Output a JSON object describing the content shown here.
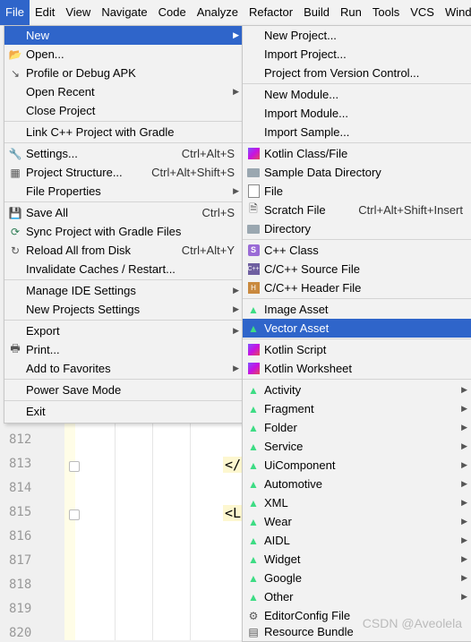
{
  "menubar": {
    "items": [
      {
        "label": "File",
        "active": true
      },
      {
        "label": "Edit"
      },
      {
        "label": "View"
      },
      {
        "label": "Navigate"
      },
      {
        "label": "Code"
      },
      {
        "label": "Analyze"
      },
      {
        "label": "Refactor"
      },
      {
        "label": "Build"
      },
      {
        "label": "Run"
      },
      {
        "label": "Tools"
      },
      {
        "label": "VCS"
      },
      {
        "label": "Wind"
      }
    ]
  },
  "editor": {
    "line_numbers": [
      "812",
      "813",
      "814",
      "815",
      "816",
      "817",
      "818",
      "819",
      "820"
    ],
    "code_tags": [
      "</",
      "<L"
    ]
  },
  "file_menu": {
    "items": [
      {
        "label": "New",
        "highlight": true,
        "submenu": true
      },
      {
        "label": "Open...",
        "icon": "folder-open-icon"
      },
      {
        "label": "Profile or Debug APK",
        "icon": "profile-icon"
      },
      {
        "label": "Open Recent",
        "submenu": true
      },
      {
        "label": "Close Project"
      },
      {
        "label": "Link C++ Project with Gradle"
      },
      {
        "label": "Settings...",
        "shortcut": "Ctrl+Alt+S",
        "icon": "wrench-icon"
      },
      {
        "label": "Project Structure...",
        "shortcut": "Ctrl+Alt+Shift+S",
        "icon": "project-structure-icon"
      },
      {
        "label": "File Properties",
        "submenu": true
      },
      {
        "label": "Save All",
        "shortcut": "Ctrl+S",
        "icon": "save-icon"
      },
      {
        "label": "Sync Project with Gradle Files",
        "icon": "gradle-sync-icon"
      },
      {
        "label": "Reload All from Disk",
        "shortcut": "Ctrl+Alt+Y",
        "icon": "reload-icon"
      },
      {
        "label": "Invalidate Caches / Restart..."
      },
      {
        "label": "Manage IDE Settings",
        "submenu": true
      },
      {
        "label": "New Projects Settings",
        "submenu": true
      },
      {
        "label": "Export",
        "submenu": true
      },
      {
        "label": "Print...",
        "icon": "print-icon"
      },
      {
        "label": "Add to Favorites",
        "submenu": true
      },
      {
        "label": "Power Save Mode"
      },
      {
        "label": "Exit"
      }
    ]
  },
  "new_submenu": {
    "items": [
      {
        "label": "New Project..."
      },
      {
        "label": "Import Project..."
      },
      {
        "label": "Project from Version Control..."
      },
      {
        "label": "New Module..."
      },
      {
        "label": "Import Module..."
      },
      {
        "label": "Import Sample..."
      },
      {
        "label": "Kotlin Class/File",
        "icon": "kotlin-icon"
      },
      {
        "label": "Sample Data Directory",
        "icon": "folder-icon"
      },
      {
        "label": "File",
        "icon": "file-icon"
      },
      {
        "label": "Scratch File",
        "shortcut": "Ctrl+Alt+Shift+Insert",
        "icon": "scratch-file-icon"
      },
      {
        "label": "Directory",
        "icon": "folder-icon"
      },
      {
        "label": "C++ Class",
        "icon": "cpp-class-icon"
      },
      {
        "label": "C/C++ Source File",
        "icon": "cpp-source-icon"
      },
      {
        "label": "C/C++ Header File",
        "icon": "header-file-icon"
      },
      {
        "label": "Image Asset",
        "icon": "android-icon"
      },
      {
        "label": "Vector Asset",
        "icon": "android-icon",
        "highlight": true
      },
      {
        "label": "Kotlin Script",
        "icon": "kotlin-icon"
      },
      {
        "label": "Kotlin Worksheet",
        "icon": "kotlin-icon"
      },
      {
        "label": "Activity",
        "icon": "android-icon",
        "submenu": true
      },
      {
        "label": "Fragment",
        "icon": "android-icon",
        "submenu": true
      },
      {
        "label": "Folder",
        "icon": "android-icon",
        "submenu": true
      },
      {
        "label": "Service",
        "icon": "android-icon",
        "submenu": true
      },
      {
        "label": "UiComponent",
        "icon": "android-icon",
        "submenu": true
      },
      {
        "label": "Automotive",
        "icon": "android-icon",
        "submenu": true
      },
      {
        "label": "XML",
        "icon": "android-icon",
        "submenu": true
      },
      {
        "label": "Wear",
        "icon": "android-icon",
        "submenu": true
      },
      {
        "label": "AIDL",
        "icon": "android-icon",
        "submenu": true
      },
      {
        "label": "Widget",
        "icon": "android-icon",
        "submenu": true
      },
      {
        "label": "Google",
        "icon": "android-icon",
        "submenu": true
      },
      {
        "label": "Other",
        "icon": "android-icon",
        "submenu": true
      },
      {
        "label": "EditorConfig File",
        "icon": "editorconfig-icon"
      },
      {
        "label": "Resource Bundle",
        "icon": "resource-bundle-icon"
      }
    ]
  },
  "watermark": "CSDN @Aveolela"
}
